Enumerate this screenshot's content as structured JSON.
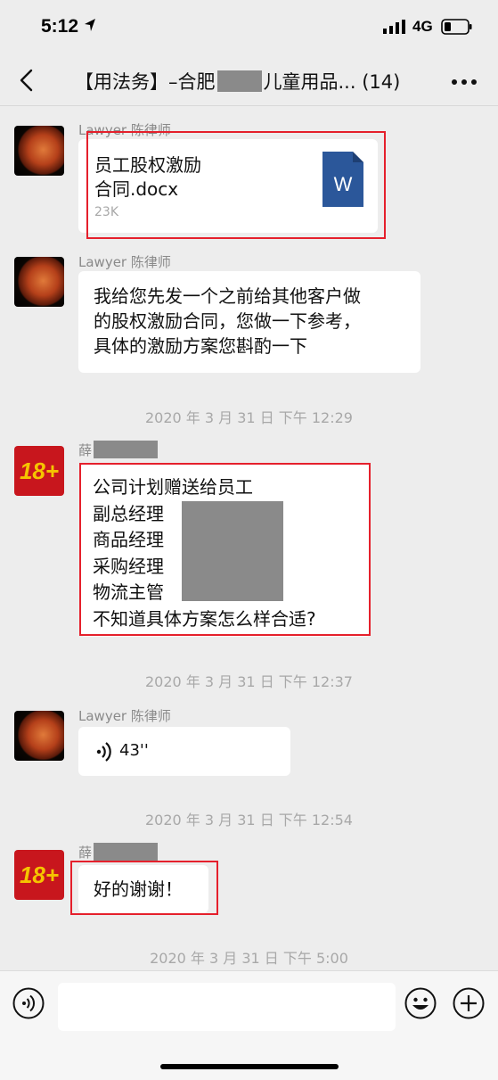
{
  "status_bar": {
    "time": "5:12",
    "network": "4G"
  },
  "nav": {
    "title_prefix": "【用法务】–合肥",
    "title_suffix": "儿童用品...",
    "member_count": "(14)"
  },
  "messages": [
    {
      "type": "file",
      "sender": "Lawyer 陈律师",
      "file_name": "员工股权激励\n合同.docx",
      "file_size": "23K",
      "file_icon_letter": "W"
    },
    {
      "type": "text",
      "sender": "Lawyer 陈律师",
      "text": "我给您先发一个之前给其他客户做\n的股权激励合同，您做一下参考，\n具体的激励方案您斟酌一下"
    },
    {
      "type": "timestamp",
      "text": "2020 年 3 月 31 日  下午 12:29"
    },
    {
      "type": "text",
      "sender_prefix": "薛",
      "avatar_text": "18+",
      "text": "公司计划赠送给员工\n副总经理\n商品经理\n采购经理\n物流主管\n不知道具体方案怎么样合适?"
    },
    {
      "type": "timestamp",
      "text": "2020 年 3 月 31 日  下午 12:37"
    },
    {
      "type": "voice",
      "sender": "Lawyer 陈律师",
      "duration": "43''"
    },
    {
      "type": "timestamp",
      "text": "2020 年 3 月 31 日  下午 12:54"
    },
    {
      "type": "text",
      "sender_prefix": "薛",
      "avatar_text": "18+",
      "text": "好的谢谢！"
    },
    {
      "type": "timestamp",
      "text": "2020 年 3 月 31 日  下午 5:00"
    }
  ],
  "colors": {
    "highlight": "#e5202c",
    "redaction": "#8a8a8a",
    "word_blue": "#2b579a"
  }
}
